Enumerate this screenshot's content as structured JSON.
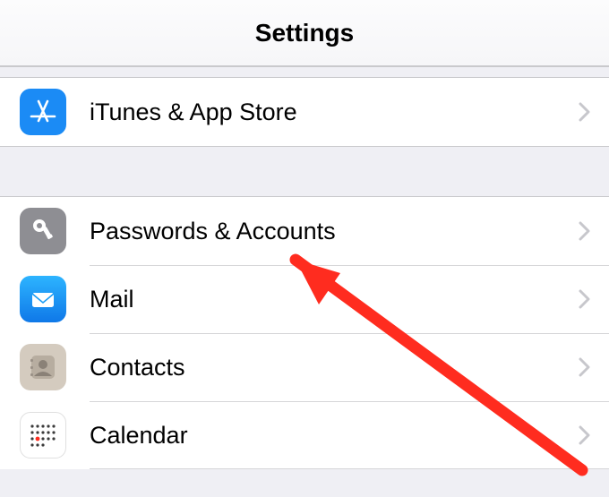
{
  "header": {
    "title": "Settings"
  },
  "sections": {
    "group1": {
      "itunes": {
        "label": "iTunes & App Store",
        "icon": "appstore-icon"
      }
    },
    "group2": {
      "passwords": {
        "label": "Passwords & Accounts",
        "icon": "key-icon"
      },
      "mail": {
        "label": "Mail",
        "icon": "mail-icon"
      },
      "contacts": {
        "label": "Contacts",
        "icon": "contacts-icon"
      },
      "calendar": {
        "label": "Calendar",
        "icon": "calendar-icon"
      }
    }
  },
  "colors": {
    "appstore_bg": "#1b8bf5",
    "key_bg": "#8e8e93",
    "mail_bg": "#1a9cf5",
    "contacts_bg": "#cfc7bd",
    "calendar_bg": "#ffffff",
    "arrow": "#ff2c1f"
  }
}
